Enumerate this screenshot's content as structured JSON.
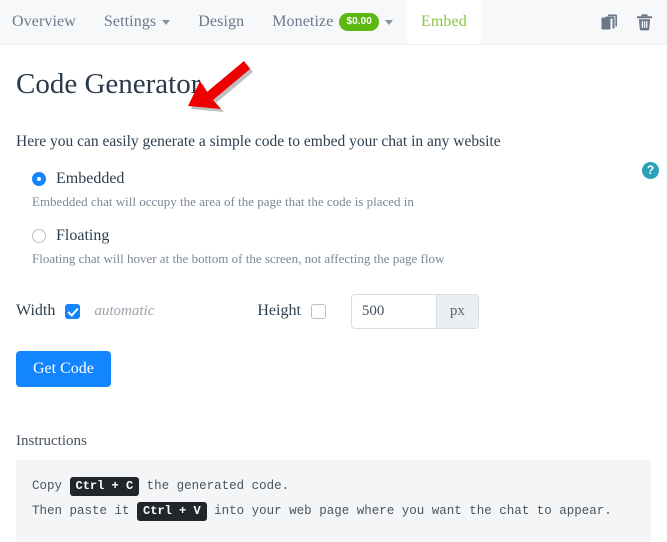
{
  "navbar": {
    "items": [
      {
        "label": "Overview",
        "has_caret": false,
        "active": false
      },
      {
        "label": "Settings",
        "has_caret": true,
        "active": false
      },
      {
        "label": "Design",
        "has_caret": false,
        "active": false
      },
      {
        "label": "Monetize",
        "has_caret": true,
        "active": false,
        "badge": "$0.00"
      },
      {
        "label": "Embed",
        "has_caret": false,
        "active": true
      }
    ],
    "actions": [
      {
        "name": "copy-icon",
        "title": "Copy"
      },
      {
        "name": "trash-icon",
        "title": "Delete"
      }
    ],
    "badge_color": "#5cb811",
    "active_color": "#8cc63f"
  },
  "page": {
    "title": "Code Generator",
    "help_label": "?",
    "intro": "Here you can easily generate a simple code to embed your chat in any website"
  },
  "options": [
    {
      "label": "Embedded",
      "selected": true,
      "hint": "Embedded chat will occupy the area of the page that the code is placed in"
    },
    {
      "label": "Floating",
      "selected": false,
      "hint": "Floating chat will hover at the bottom of the screen, not affecting the page flow"
    }
  ],
  "size": {
    "width_label": "Width",
    "width_auto_checked": true,
    "width_auto_text": "automatic",
    "height_label": "Height",
    "height_auto_checked": false,
    "height_value": "500",
    "height_unit": "px"
  },
  "actions": {
    "get_code_label": "Get Code"
  },
  "instructions": {
    "title": "Instructions",
    "line1_before": "Copy",
    "line1_kbd": "Ctrl + C",
    "line1_after": "the generated code.",
    "line2_before": "Then paste it",
    "line2_kbd": "Ctrl + V",
    "line2_after": "into your web page where you want the chat to appear."
  },
  "annotation": {
    "type": "arrow",
    "color": "#ee0000",
    "points_to": "page-title"
  }
}
